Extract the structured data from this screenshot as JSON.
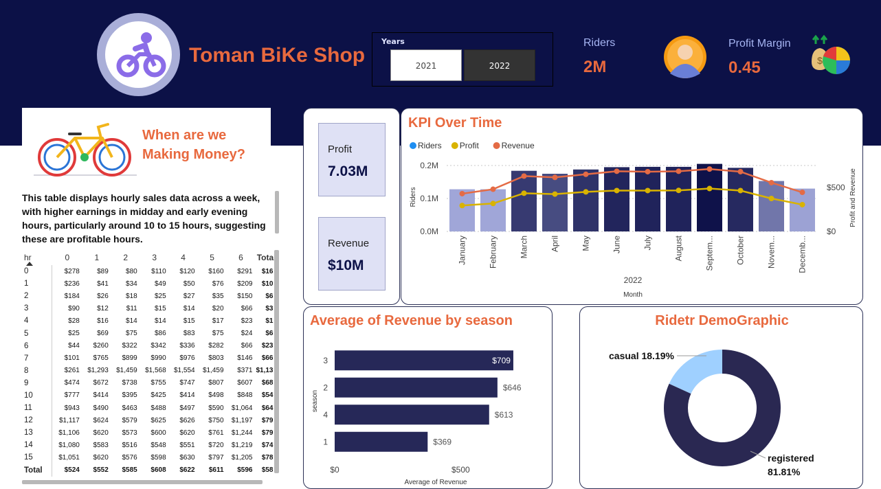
{
  "header": {
    "title": "Toman BiKe Shop",
    "years": {
      "label": "Years",
      "options": [
        "2021",
        "2022"
      ],
      "selected": "2022"
    },
    "riders": {
      "label": "Riders",
      "value": "2M"
    },
    "profit_margin": {
      "label": "Profit Margin",
      "value": "0.45"
    }
  },
  "money_panel": {
    "title": "When are we Making Money?",
    "description": "This table displays hourly sales data across a week, with higher earnings in midday and early evening hours, particularly around 10 to 15 hours, suggesting these are profitable hours."
  },
  "hourly_table": {
    "columns": [
      "hr",
      "0",
      "1",
      "2",
      "3",
      "4",
      "5",
      "6",
      "Total"
    ],
    "rows": [
      [
        "0",
        "$278",
        "$89",
        "$80",
        "$110",
        "$120",
        "$160",
        "$291",
        "$16"
      ],
      [
        "1",
        "$236",
        "$41",
        "$34",
        "$49",
        "$50",
        "$76",
        "$209",
        "$10"
      ],
      [
        "2",
        "$184",
        "$26",
        "$18",
        "$25",
        "$27",
        "$35",
        "$150",
        "$6"
      ],
      [
        "3",
        "$90",
        "$12",
        "$11",
        "$15",
        "$14",
        "$20",
        "$66",
        "$3"
      ],
      [
        "4",
        "$28",
        "$16",
        "$14",
        "$14",
        "$15",
        "$17",
        "$23",
        "$1"
      ],
      [
        "5",
        "$25",
        "$69",
        "$75",
        "$86",
        "$83",
        "$75",
        "$24",
        "$6"
      ],
      [
        "6",
        "$44",
        "$260",
        "$322",
        "$342",
        "$336",
        "$282",
        "$66",
        "$23"
      ],
      [
        "7",
        "$101",
        "$765",
        "$899",
        "$990",
        "$976",
        "$803",
        "$146",
        "$66"
      ],
      [
        "8",
        "$261",
        "$1,293",
        "$1,459",
        "$1,568",
        "$1,554",
        "$1,459",
        "$371",
        "$1,13"
      ],
      [
        "9",
        "$474",
        "$672",
        "$738",
        "$755",
        "$747",
        "$807",
        "$607",
        "$68"
      ],
      [
        "10",
        "$777",
        "$414",
        "$395",
        "$425",
        "$414",
        "$498",
        "$848",
        "$54"
      ],
      [
        "11",
        "$943",
        "$490",
        "$463",
        "$488",
        "$497",
        "$590",
        "$1,064",
        "$64"
      ],
      [
        "12",
        "$1,117",
        "$624",
        "$579",
        "$625",
        "$626",
        "$750",
        "$1,197",
        "$79"
      ],
      [
        "13",
        "$1,106",
        "$620",
        "$573",
        "$600",
        "$620",
        "$761",
        "$1,244",
        "$79"
      ],
      [
        "14",
        "$1,080",
        "$583",
        "$516",
        "$548",
        "$551",
        "$720",
        "$1,219",
        "$74"
      ],
      [
        "15",
        "$1,051",
        "$620",
        "$576",
        "$598",
        "$630",
        "$797",
        "$1,205",
        "$78"
      ]
    ],
    "total_row": [
      "Total",
      "$524",
      "$552",
      "$585",
      "$608",
      "$622",
      "$611",
      "$596",
      "$58"
    ]
  },
  "kpi_cards": {
    "profit": {
      "label": "Profit",
      "value": "7.03M"
    },
    "revenue": {
      "label": "Revenue",
      "value": "$10M"
    }
  },
  "colors": {
    "banner": "#0c1147",
    "accent": "#e8693e",
    "riders_dot": "#1f8ef1",
    "profit_line": "#d9b300",
    "revenue_line": "#e46b45",
    "bar_dark": "#262858",
    "casual": "#9fd0ff",
    "registered": "#2a2852"
  },
  "chart_data": [
    {
      "type": "bar",
      "title": "KPI Over Time",
      "legend": [
        "Riders",
        "Profit",
        "Revenue"
      ],
      "legend_position": "top-left",
      "categories": [
        "January",
        "February",
        "March",
        "April",
        "May",
        "June",
        "July",
        "August",
        "Septem...",
        "October",
        "Novem...",
        "Decemb..."
      ],
      "x_group_label": "2022",
      "xlabel": "Month",
      "ylabel": "Riders",
      "y2label": "Profit and Revenue",
      "y_ticks": [
        "0.0M",
        "0.1M",
        "0.2M"
      ],
      "y2_ticks": [
        "$0",
        "$500"
      ],
      "ylim": [
        0,
        0.2
      ],
      "y2lim": [
        0,
        750
      ],
      "series": [
        {
          "name": "Riders",
          "type": "bar",
          "values": [
            0.128,
            0.128,
            0.184,
            0.175,
            0.188,
            0.195,
            0.196,
            0.196,
            0.205,
            0.193,
            0.153,
            0.13
          ]
        },
        {
          "name": "Profit",
          "type": "line",
          "axis": "secondary",
          "values": [
            295,
            318,
            435,
            425,
            450,
            465,
            465,
            467,
            488,
            465,
            375,
            305
          ]
        },
        {
          "name": "Revenue",
          "type": "line",
          "axis": "secondary",
          "values": [
            430,
            480,
            630,
            615,
            650,
            685,
            680,
            685,
            710,
            680,
            555,
            445
          ]
        }
      ],
      "grid": true
    },
    {
      "type": "bar",
      "orientation": "horizontal",
      "title": "Average of Revenue by season",
      "categories": [
        "3",
        "2",
        "4",
        "1"
      ],
      "values": [
        709,
        646,
        613,
        369
      ],
      "value_labels": [
        "$709",
        "$646",
        "$613",
        "$369"
      ],
      "xlabel": "Average of Revenue",
      "ylabel": "season",
      "x_ticks": [
        "$0",
        "$500"
      ],
      "xlim": [
        0,
        750
      ]
    },
    {
      "type": "pie",
      "title": "Ridetr DemoGraphic",
      "categories": [
        "casual",
        "registered"
      ],
      "values": [
        18.19,
        81.81
      ],
      "labels": [
        "casual 18.19%",
        "registered",
        "81.81%"
      ]
    }
  ]
}
